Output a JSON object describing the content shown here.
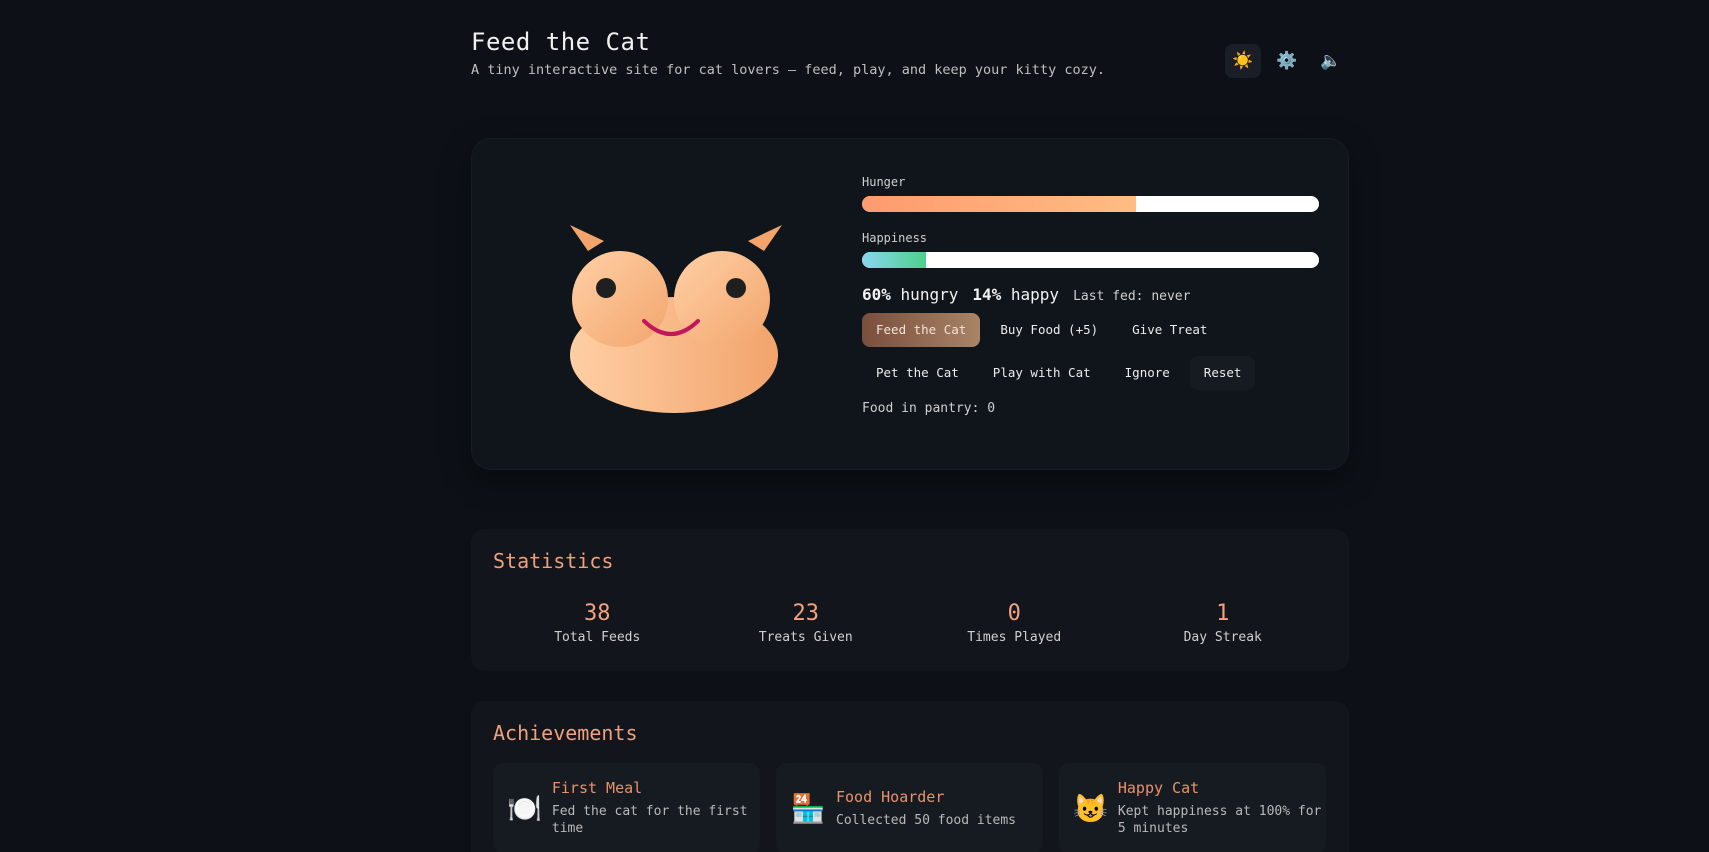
{
  "header": {
    "title": "Feed the Cat",
    "subtitle": "A tiny interactive site for cat lovers — feed, play, and keep your kitty cozy.",
    "icons": [
      "sun-icon",
      "gear-icon",
      "speaker-icon"
    ],
    "icon_glyphs": [
      "☀️",
      "⚙️",
      "🔈"
    ]
  },
  "meters": {
    "hunger_label": "Hunger",
    "hunger_value": 0.6,
    "happiness_label": "Happiness",
    "happiness_value": 0.14
  },
  "status": {
    "hunger_pct": "60%",
    "hunger_word": "hungry",
    "happy_pct": "14%",
    "happy_word": "happy",
    "last_fed": "Last fed: never"
  },
  "actions": {
    "feed": "Feed the Cat",
    "buy_food": "Buy Food (+5)",
    "treat": "Give Treat",
    "pet": "Pet the Cat",
    "play": "Play with Cat",
    "ignore": "Ignore",
    "reset": "Reset"
  },
  "pantry": "Food in pantry: 0",
  "statistics": {
    "title": "Statistics",
    "items": [
      {
        "value": "38",
        "label": "Total Feeds"
      },
      {
        "value": "23",
        "label": "Treats Given"
      },
      {
        "value": "0",
        "label": "Times Played"
      },
      {
        "value": "1",
        "label": "Day Streak"
      }
    ]
  },
  "achievements": {
    "title": "Achievements",
    "items": [
      {
        "icon": "🍽️",
        "icon_name": "plate-icon",
        "title": "First Meal",
        "desc": "Fed the cat for the first time"
      },
      {
        "icon": "🏪",
        "icon_name": "store-icon",
        "title": "Food Hoarder",
        "desc": "Collected 50 food items"
      },
      {
        "icon": "😺",
        "icon_name": "cat-face-icon",
        "title": "Happy Cat",
        "desc": "Kept happiness at 100% for 5 minutes"
      }
    ]
  },
  "colors": {
    "background": "#0d1117",
    "accent": "#f4a27e",
    "cat_fur": "#f6b27e"
  }
}
